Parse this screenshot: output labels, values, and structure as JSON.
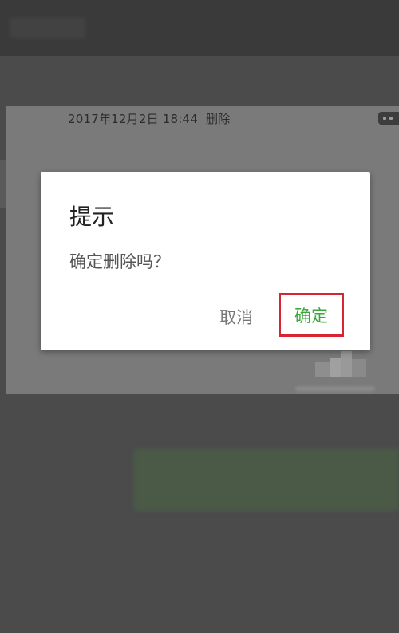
{
  "background": {
    "timestamp": "2017年12月2日 18:44",
    "delete_label": "删除"
  },
  "dialog": {
    "title": "提示",
    "message": "确定删除吗？",
    "cancel_label": "取消",
    "confirm_label": "确定"
  },
  "colors": {
    "confirm_text": "#3aa73a",
    "highlight_border": "#d62633"
  }
}
